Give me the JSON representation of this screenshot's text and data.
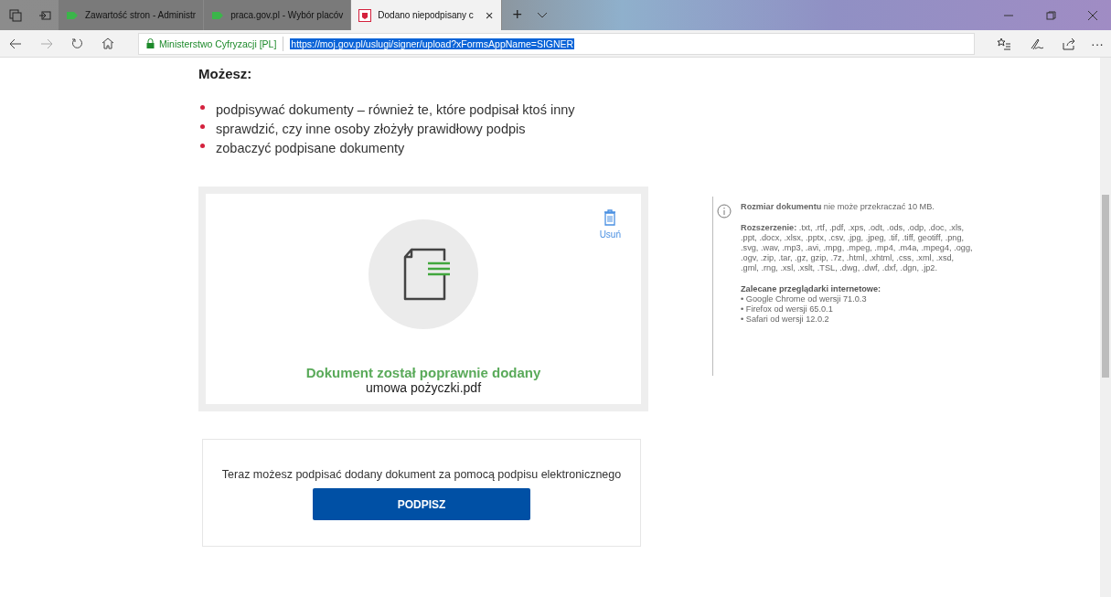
{
  "browser": {
    "tabs": [
      {
        "title": "Zawartość stron - Administr",
        "selected": false,
        "kind": "generic"
      },
      {
        "title": "praca.gov.pl - Wybór placóv",
        "selected": false,
        "kind": "generic"
      },
      {
        "title": "Dodano niepodpisany c",
        "selected": true,
        "kind": "emblem"
      }
    ],
    "tab_close": "×",
    "new_tab": "+",
    "site_identity": "Ministerstwo Cyfryzacji [PL]",
    "url": "https://moj.gov.pl/uslugi/signer/upload?xFormsAppName=SIGNER",
    "more": "···"
  },
  "page": {
    "heading": "Możesz:",
    "bullets": [
      "podpisywać dokumenty – również te, które podpisał ktoś inny",
      "sprawdzić, czy inne osoby złożyły prawidłowy podpis",
      "zobaczyć podpisane dokumenty"
    ],
    "upload_card": {
      "delete_label": "Usuń",
      "status": "Dokument został poprawnie dodany",
      "file_name": "umowa pożyczki.pdf"
    },
    "sign_box": {
      "text": "Teraz możesz podpisać dodany dokument za pomocą podpisu elektronicznego",
      "button": "PODPISZ"
    },
    "info": {
      "size_note": "**Rozmiar dokumentu** nie może przekraczać 10 MB.",
      "extensions": "**Rozszerzenie:** .txt, .rtf, .pdf, .xps, .odt, .ods, .odp, .doc, .xls, .ppt, .docx, .xlsx, .pptx, .csv, .jpg, .jpeg, .tif, .tiff, geotiff, .png, .svg, .wav, .mp3, .avi, .mpg, .mpeg, .mp4, .m4a, .mpeg4, .ogg, .ogv, .zip, .tar, .gz, gzip, .7z, .html, .xhtml, .css, .xml, .xsd, .gml, .rng, .xsl, .xslt, .TSL, .dwg, .dwf, .dxf, .dgn, .jp2.",
      "browsers_heading": "Zalecane przeglądarki internetowe:",
      "browsers": [
        "• Google Chrome od wersji 71.0.3",
        "• Firefox od wersji 65.0.1",
        "• Safari od wersji 12.0.2"
      ]
    }
  }
}
